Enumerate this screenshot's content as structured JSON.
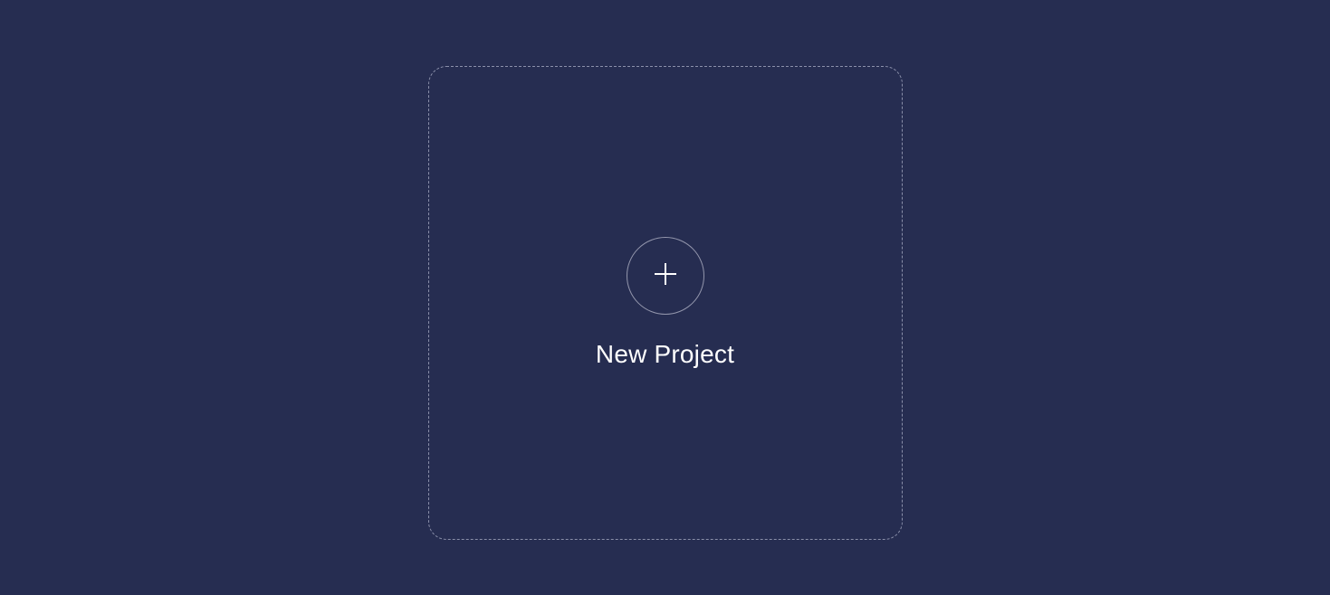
{
  "newProject": {
    "label": "New Project"
  }
}
